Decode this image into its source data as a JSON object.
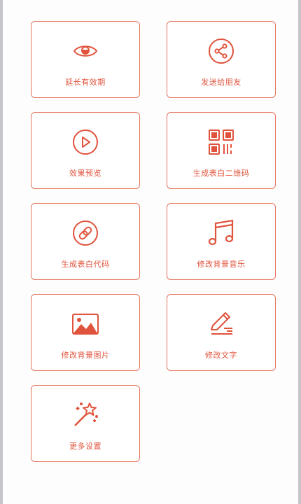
{
  "accent_color": "#e0533c",
  "actions": [
    {
      "label": "延长有效期",
      "icon": "eye-icon"
    },
    {
      "label": "发送给朋友",
      "icon": "share-icon"
    },
    {
      "label": "效果预览",
      "icon": "play-icon"
    },
    {
      "label": "生成表白二维码",
      "icon": "qr-code-icon"
    },
    {
      "label": "生成表白代码",
      "icon": "link-icon"
    },
    {
      "label": "修改背景音乐",
      "icon": "music-icon"
    },
    {
      "label": "修改背景图片",
      "icon": "image-icon"
    },
    {
      "label": "修改文字",
      "icon": "edit-text-icon"
    },
    {
      "label": "更多设置",
      "icon": "magic-wand-icon"
    }
  ]
}
